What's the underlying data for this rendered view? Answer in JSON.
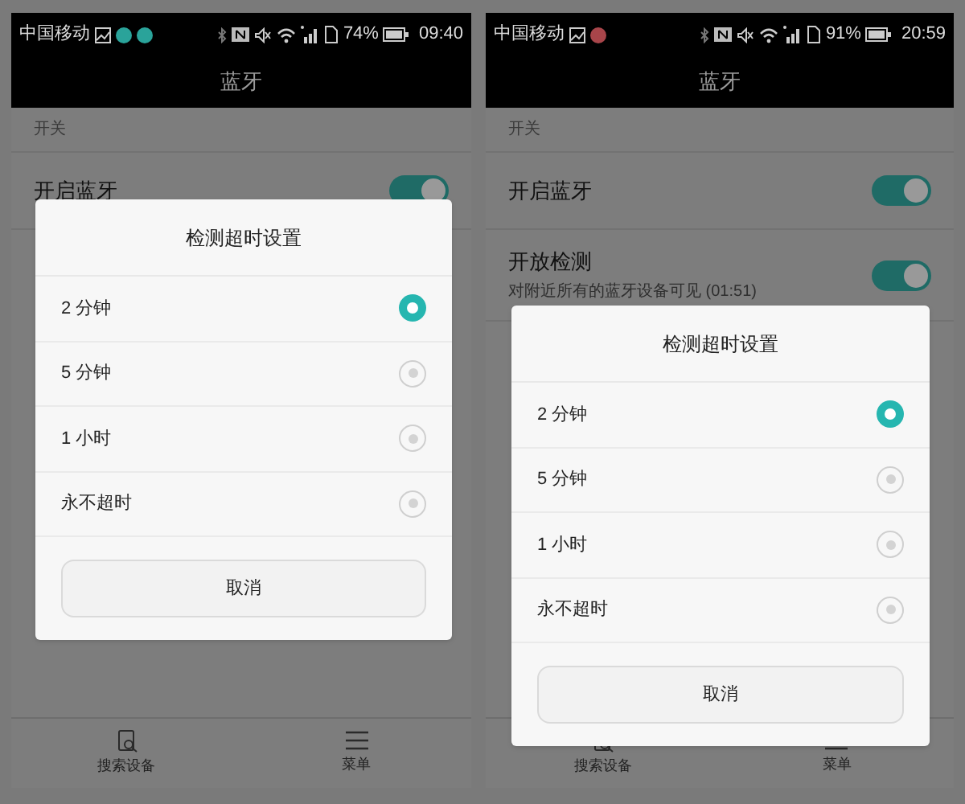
{
  "phones": [
    {
      "status_bar": {
        "carrier": "中国移动",
        "notification_icons": [
          {
            "color": "#2aa39a"
          },
          {
            "color": "#2aa39a"
          }
        ],
        "battery": "74%",
        "time": "09:40"
      },
      "title": "蓝牙",
      "section": "开关",
      "settings": [
        {
          "title": "开启蓝牙",
          "on": true
        }
      ],
      "bottom_bar": [
        {
          "kind": "search",
          "label": "搜索设备"
        },
        {
          "kind": "menu",
          "label": "菜单"
        }
      ],
      "dialog": {
        "title": "检测超时设置",
        "options": [
          {
            "label": "2 分钟",
            "selected": true
          },
          {
            "label": "5 分钟",
            "selected": false
          },
          {
            "label": "1 小时",
            "selected": false
          },
          {
            "label": "永不超时",
            "selected": false
          }
        ],
        "cancel": "取消"
      }
    },
    {
      "status_bar": {
        "carrier": "中国移动",
        "notification_icons": [
          {
            "color": "#a8454a"
          }
        ],
        "battery": "91%",
        "time": "20:59"
      },
      "title": "蓝牙",
      "section": "开关",
      "settings": [
        {
          "title": "开启蓝牙",
          "on": true
        },
        {
          "title": "开放检测",
          "subtitle": "对附近所有的蓝牙设备可见 (01:51)",
          "on": true
        }
      ],
      "bottom_bar": [
        {
          "kind": "search",
          "label": "搜索设备"
        },
        {
          "kind": "menu",
          "label": "菜单"
        }
      ],
      "dialog": {
        "title": "检测超时设置",
        "options": [
          {
            "label": "2 分钟",
            "selected": true
          },
          {
            "label": "5 分钟",
            "selected": false
          },
          {
            "label": "1 小时",
            "selected": false
          },
          {
            "label": "永不超时",
            "selected": false
          }
        ],
        "cancel": "取消"
      }
    }
  ]
}
